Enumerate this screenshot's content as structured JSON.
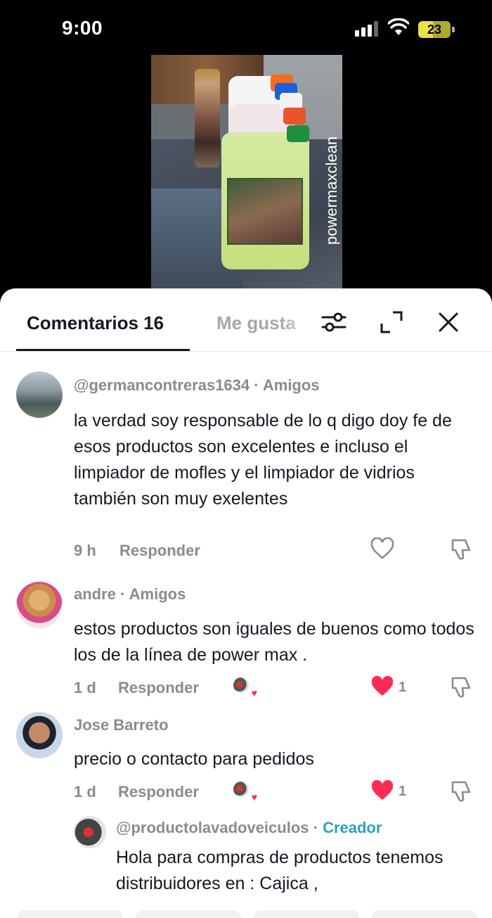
{
  "status_bar": {
    "time": "9:00",
    "battery": "23"
  },
  "video": {
    "watermark": "powermaxclean"
  },
  "tabs": {
    "comments_label": "Comentarios 16",
    "likes_label": "Me gusta"
  },
  "comments": [
    {
      "username": "@germancontreras1634",
      "relation": "Amigos",
      "text": "la verdad soy responsable de lo q digo doy fe de esos productos son excelentes e incluso el limpiador de mofles y el limpiador de vidrios también son muy exelentes",
      "time": "9 h",
      "reply_label": "Responder",
      "likes": "",
      "liked": false
    },
    {
      "username": "andre",
      "relation": "Amigos",
      "text": "estos productos son iguales de buenos como todos los de la línea de power max .",
      "time": "1 d",
      "reply_label": "Responder",
      "likes": "1",
      "liked": true
    },
    {
      "username": "Jose Barreto",
      "relation": "",
      "text": "precio o contacto para pedidos",
      "time": "1 d",
      "reply_label": "Responder",
      "likes": "1",
      "liked": true
    }
  ],
  "reply": {
    "username": "@productolavadoveiculos",
    "badge": "Creador",
    "text": "Hola para compras de productos tenemos distribuidores en : Cajica ,"
  },
  "colors": {
    "like_red": "#fe2c55",
    "creator_blue": "#2aa1c0",
    "muted": "#8a8b91",
    "text": "#161823"
  }
}
